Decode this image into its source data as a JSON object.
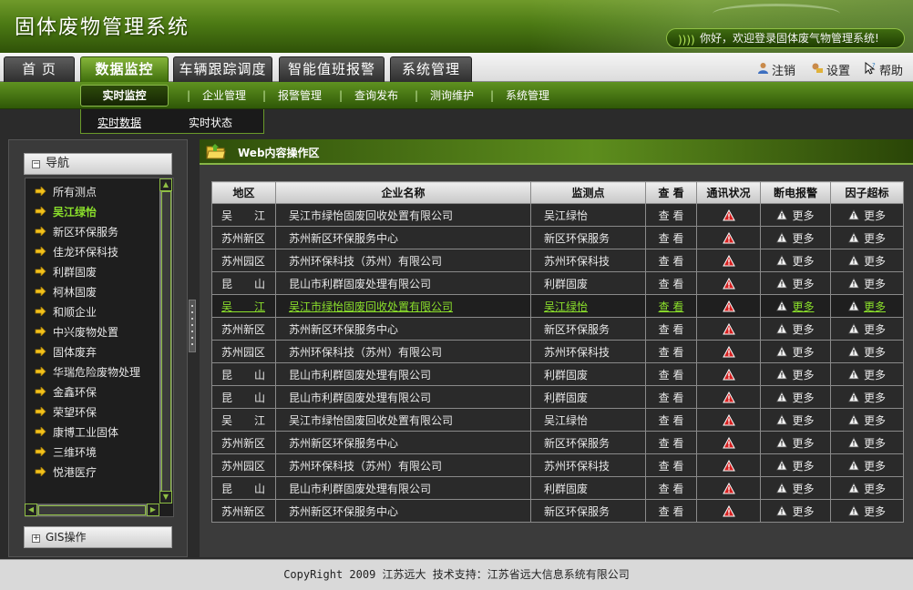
{
  "header": {
    "title": "固体废物管理系统",
    "welcome": "你好，欢迎登录固体废气物管理系统!"
  },
  "main_tabs": [
    {
      "label": "首 页",
      "active": false
    },
    {
      "label": "数据监控",
      "active": true
    },
    {
      "label": "车辆跟踪调度",
      "active": false
    },
    {
      "label": "智能值班报警",
      "active": false
    },
    {
      "label": "系统管理",
      "active": false
    }
  ],
  "toolbar": {
    "logout": "注销",
    "settings": "设置",
    "help": "帮助"
  },
  "subnav": {
    "active": "实时监控",
    "items": [
      "企业管理",
      "报警管理",
      "查询发布",
      "测询维护",
      "系统管理"
    ],
    "sub_items": [
      "实时数据",
      "实时状态"
    ]
  },
  "sidebar": {
    "nav_header": "导航",
    "gis_header": "GIS操作",
    "items": [
      {
        "label": "所有测点",
        "active": false
      },
      {
        "label": "吴江绿怡",
        "active": true
      },
      {
        "label": "新区环保服务",
        "active": false
      },
      {
        "label": "佳龙环保科技",
        "active": false
      },
      {
        "label": "利群固废",
        "active": false
      },
      {
        "label": "柯林固废",
        "active": false
      },
      {
        "label": "和顺企业",
        "active": false
      },
      {
        "label": "中兴废物处置",
        "active": false
      },
      {
        "label": "固体废弃",
        "active": false
      },
      {
        "label": "华瑞危险废物处理",
        "active": false
      },
      {
        "label": "金鑫环保",
        "active": false
      },
      {
        "label": "荣望环保",
        "active": false
      },
      {
        "label": "康博工业固体",
        "active": false
      },
      {
        "label": "三维环境",
        "active": false
      },
      {
        "label": "悦港医疗",
        "active": false
      }
    ]
  },
  "content": {
    "title": "Web内容操作区",
    "columns": [
      "地区",
      "企业名称",
      "监测点",
      "查 看",
      "通讯状况",
      "断电报警",
      "因子超标"
    ],
    "view_label": "查 看",
    "more_label": "更多",
    "rows": [
      {
        "region": "吴　　江",
        "company": "吴江市绿怡固废回收处置有限公司",
        "point": "吴江绿怡",
        "highlight": false
      },
      {
        "region": "苏州新区",
        "company": "苏州新区环保服务中心",
        "point": "新区环保服务",
        "highlight": false
      },
      {
        "region": "苏州园区",
        "company": "苏州环保科技（苏州）有限公司",
        "point": "苏州环保科技",
        "highlight": false
      },
      {
        "region": "昆　　山",
        "company": "昆山市利群固废处理有限公司",
        "point": "利群固废",
        "highlight": false
      },
      {
        "region": "吴　　江",
        "company": "吴江市绿怡固废回收处置有限公司",
        "point": "吴江绿怡",
        "highlight": true
      },
      {
        "region": "苏州新区",
        "company": "苏州新区环保服务中心",
        "point": "新区环保服务",
        "highlight": false
      },
      {
        "region": "苏州园区",
        "company": "苏州环保科技（苏州）有限公司",
        "point": "苏州环保科技",
        "highlight": false
      },
      {
        "region": "昆　　山",
        "company": "昆山市利群固废处理有限公司",
        "point": "利群固废",
        "highlight": false
      },
      {
        "region": "昆　　山",
        "company": "昆山市利群固废处理有限公司",
        "point": "利群固废",
        "highlight": false
      },
      {
        "region": "吴　　江",
        "company": "吴江市绿怡固废回收处置有限公司",
        "point": "吴江绿怡",
        "highlight": false
      },
      {
        "region": "苏州新区",
        "company": "苏州新区环保服务中心",
        "point": "新区环保服务",
        "highlight": false
      },
      {
        "region": "苏州园区",
        "company": "苏州环保科技（苏州）有限公司",
        "point": "苏州环保科技",
        "highlight": false
      },
      {
        "region": "昆　　山",
        "company": "昆山市利群固废处理有限公司",
        "point": "利群固废",
        "highlight": false
      },
      {
        "region": "苏州新区",
        "company": "苏州新区环保服务中心",
        "point": "新区环保服务",
        "highlight": false
      }
    ]
  },
  "footer": {
    "text": "CopyRight 2009 江苏远大 技术支持：江苏省远大信息系统有限公司"
  },
  "colors": {
    "accent_green": "#8be02b",
    "header_green": "#4c7a14",
    "alarm_red": "#d62020",
    "warning_yellow": "#f3c21c"
  },
  "icons": {
    "nav_bullet": "arrow-right-icon",
    "comm_status": "red-warning-icon",
    "alarm": "white-warning-icon",
    "logout": "user-icon",
    "settings": "settings-icon",
    "help": "help-cursor-icon"
  }
}
